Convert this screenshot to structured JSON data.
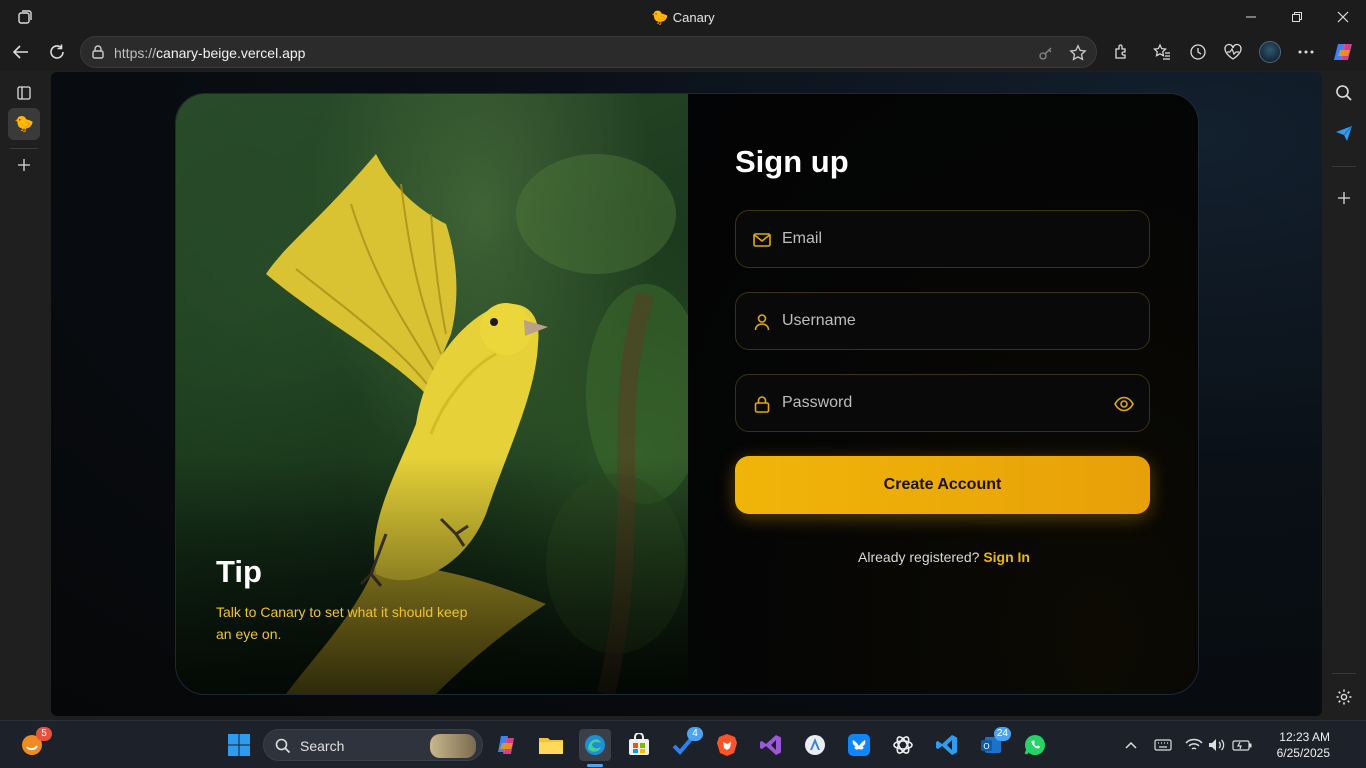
{
  "window": {
    "title": "Canary"
  },
  "browser": {
    "url_prefix": "https://",
    "url_host": "canary-beige.vercel.app"
  },
  "signup": {
    "heading": "Sign up",
    "email_placeholder": "Email",
    "username_placeholder": "Username",
    "password_placeholder": "Password",
    "create_button": "Create Account",
    "already_text": "Already registered?",
    "signin_link": "Sign In"
  },
  "tip": {
    "title": "Tip",
    "text": "Talk to Canary to set what it should keep an eye on."
  },
  "taskbar": {
    "search_label": "Search",
    "copilot_badge": "5",
    "todo_badge": "4",
    "mail_badge": "24",
    "time": "12:23 AM",
    "date": "6/25/2025"
  },
  "colors": {
    "accent": "#f0b509",
    "tip_text": "#f0c230"
  }
}
